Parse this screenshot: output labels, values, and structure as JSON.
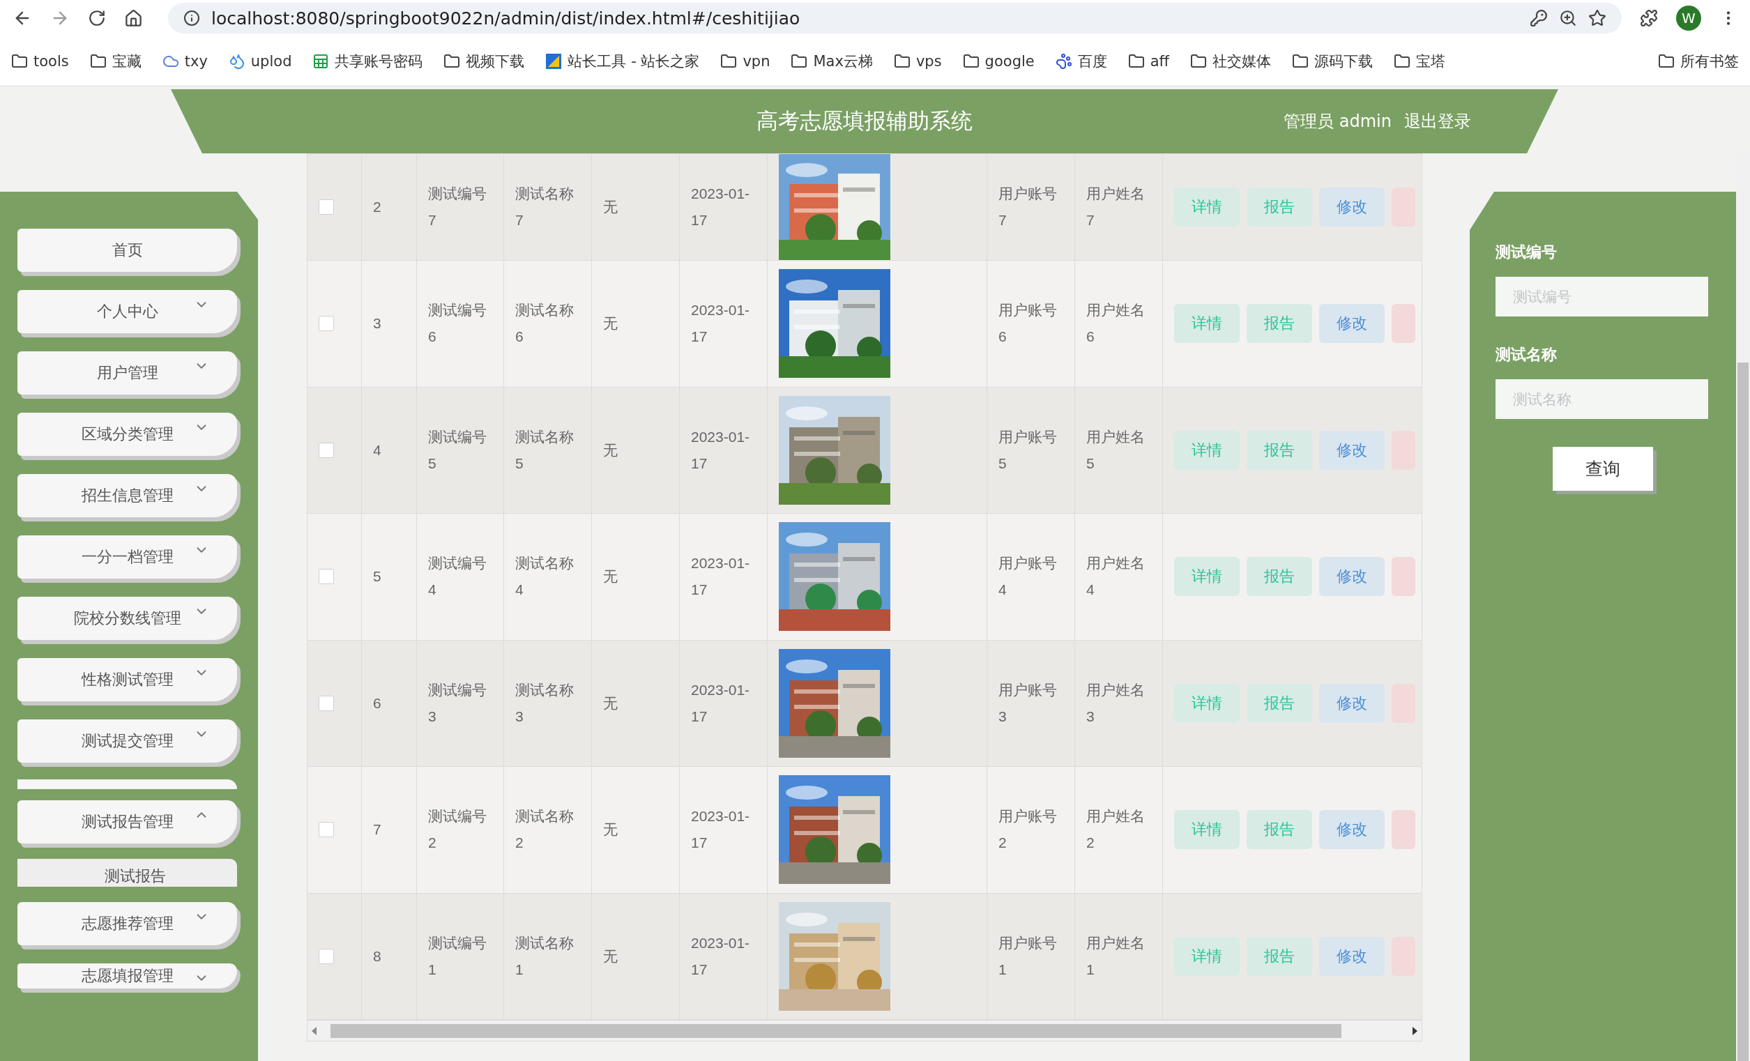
{
  "browser": {
    "url": "localhost:8080/springboot9022n/admin/dist/index.html#/ceshitijiao",
    "profile_letter": "W",
    "bookmarks": [
      {
        "label": "tools",
        "kind": "folder"
      },
      {
        "label": "宝藏",
        "kind": "folder"
      },
      {
        "label": "txy",
        "kind": "cloud"
      },
      {
        "label": "uplod",
        "kind": "drops"
      },
      {
        "label": "共享账号密码",
        "kind": "sheet"
      },
      {
        "label": "视频下载",
        "kind": "folder"
      },
      {
        "label": "站长工具 - 站长之家",
        "kind": "site"
      },
      {
        "label": "vpn",
        "kind": "folder"
      },
      {
        "label": "Max云梯",
        "kind": "folder"
      },
      {
        "label": "vps",
        "kind": "folder"
      },
      {
        "label": "google",
        "kind": "folder"
      },
      {
        "label": "百度",
        "kind": "paw"
      },
      {
        "label": "aff",
        "kind": "folder"
      },
      {
        "label": "社交媒体",
        "kind": "folder"
      },
      {
        "label": "源码下载",
        "kind": "folder"
      },
      {
        "label": "宝塔",
        "kind": "folder"
      }
    ],
    "all_bookmarks": "所有书签"
  },
  "header": {
    "title": "高考志愿填报辅助系统",
    "user": "管理员 admin",
    "logout": "退出登录"
  },
  "sidebar": {
    "items": [
      {
        "label": "首页",
        "kind": "link"
      },
      {
        "label": "个人中心",
        "kind": "menu",
        "expanded": false
      },
      {
        "label": "用户管理",
        "kind": "menu",
        "expanded": false
      },
      {
        "label": "区域分类管理",
        "kind": "menu",
        "expanded": false
      },
      {
        "label": "招生信息管理",
        "kind": "menu",
        "expanded": false
      },
      {
        "label": "一分一档管理",
        "kind": "menu",
        "expanded": false
      },
      {
        "label": "院校分数线管理",
        "kind": "menu",
        "expanded": false
      },
      {
        "label": "性格测试管理",
        "kind": "menu",
        "expanded": false
      },
      {
        "label": "测试提交管理",
        "kind": "menu",
        "expanded": false
      },
      {
        "kind": "blank"
      },
      {
        "label": "测试报告管理",
        "kind": "menu",
        "expanded": true,
        "children": [
          {
            "label": "测试报告"
          }
        ]
      },
      {
        "label": "志愿推荐管理",
        "kind": "menu",
        "expanded": false
      },
      {
        "label": "志愿填报管理",
        "kind": "menu",
        "expanded": false
      }
    ]
  },
  "table": {
    "rows": [
      {
        "checked": false,
        "index": "2",
        "code": "测试编号7",
        "name": "测试名称7",
        "remark": "无",
        "date": "2023-01-17",
        "account": "用户账号7",
        "username": "用户姓名7",
        "actions": [
          {
            "label": "详情",
            "kind": "detail"
          },
          {
            "label": "报告",
            "kind": "report"
          },
          {
            "label": "修改",
            "kind": "edit"
          },
          {
            "kind": "delete"
          }
        ]
      },
      {
        "checked": false,
        "index": "3",
        "code": "测试编号6",
        "name": "测试名称6",
        "remark": "无",
        "date": "2023-01-17",
        "account": "用户账号6",
        "username": "用户姓名6",
        "actions": [
          {
            "label": "详情",
            "kind": "detail"
          },
          {
            "label": "报告",
            "kind": "report"
          },
          {
            "label": "修改",
            "kind": "edit"
          },
          {
            "kind": "delete"
          }
        ]
      },
      {
        "checked": false,
        "index": "4",
        "code": "测试编号5",
        "name": "测试名称5",
        "remark": "无",
        "date": "2023-01-17",
        "account": "用户账号5",
        "username": "用户姓名5",
        "actions": [
          {
            "label": "详情",
            "kind": "detail"
          },
          {
            "label": "报告",
            "kind": "report"
          },
          {
            "label": "修改",
            "kind": "edit"
          },
          {
            "kind": "delete"
          }
        ]
      },
      {
        "checked": false,
        "index": "5",
        "code": "测试编号4",
        "name": "测试名称4",
        "remark": "无",
        "date": "2023-01-17",
        "account": "用户账号4",
        "username": "用户姓名4",
        "actions": [
          {
            "label": "详情",
            "kind": "detail"
          },
          {
            "label": "报告",
            "kind": "report"
          },
          {
            "label": "修改",
            "kind": "edit"
          },
          {
            "kind": "delete"
          }
        ]
      },
      {
        "checked": false,
        "index": "6",
        "code": "测试编号3",
        "name": "测试名称3",
        "remark": "无",
        "date": "2023-01-17",
        "account": "用户账号3",
        "username": "用户姓名3",
        "actions": [
          {
            "label": "详情",
            "kind": "detail"
          },
          {
            "label": "报告",
            "kind": "report"
          },
          {
            "label": "修改",
            "kind": "edit"
          },
          {
            "kind": "delete"
          }
        ]
      },
      {
        "checked": false,
        "index": "7",
        "code": "测试编号2",
        "name": "测试名称2",
        "remark": "无",
        "date": "2023-01-17",
        "account": "用户账号2",
        "username": "用户姓名2",
        "actions": [
          {
            "label": "详情",
            "kind": "detail"
          },
          {
            "label": "报告",
            "kind": "report"
          },
          {
            "label": "修改",
            "kind": "edit"
          },
          {
            "kind": "delete"
          }
        ]
      },
      {
        "checked": false,
        "index": "8",
        "code": "测试编号1",
        "name": "测试名称1",
        "remark": "无",
        "date": "2023-01-17",
        "account": "用户账号1",
        "username": "用户姓名1",
        "actions": [
          {
            "label": "详情",
            "kind": "detail"
          },
          {
            "label": "报告",
            "kind": "report"
          },
          {
            "label": "修改",
            "kind": "edit"
          },
          {
            "kind": "delete"
          }
        ]
      }
    ]
  },
  "search": {
    "fields": [
      {
        "label": "测试编号",
        "placeholder": "测试编号"
      },
      {
        "label": "测试名称",
        "placeholder": "测试名称"
      }
    ],
    "button": "查询"
  }
}
